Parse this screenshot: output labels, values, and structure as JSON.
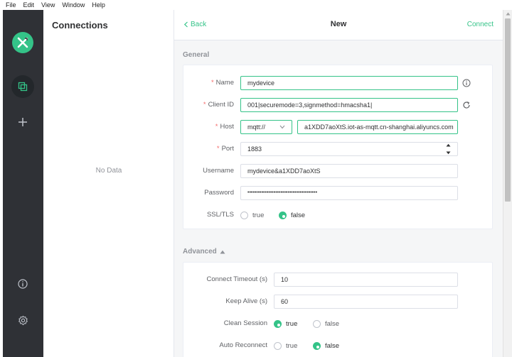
{
  "menu": [
    "File",
    "Edit",
    "Window",
    "Help"
  ],
  "menu_view": "View",
  "colors": {
    "accent": "#34c388",
    "rail": "#2f3136",
    "required": "#f56c6c"
  },
  "sidebar": {
    "icons": [
      "mqttx-logo-icon",
      "connections-icon",
      "plus-icon",
      "info-icon",
      "gear-icon"
    ]
  },
  "connections": {
    "title": "Connections",
    "empty": "No Data"
  },
  "topbar": {
    "back": "Back",
    "title": "New",
    "connect": "Connect"
  },
  "general": {
    "section": "General",
    "name": {
      "label": "Name",
      "value": "mydevice"
    },
    "client_id": {
      "label": "Client ID",
      "value": "001|securemode=3,signmethod=hmacsha1|"
    },
    "host": {
      "label": "Host",
      "protocol": "mqtt://",
      "value": "a1XDD7aoXtS.iot-as-mqtt.cn-shanghai.aliyuncs.com"
    },
    "port": {
      "label": "Port",
      "value": "1883"
    },
    "username": {
      "label": "Username",
      "value": "mydevice&a1XDD7aoXtS"
    },
    "password": {
      "label": "Password",
      "value": "••••••••••••••••••••••••••••••••••••••••"
    },
    "ssl": {
      "label": "SSL/TLS",
      "opt_true": "true",
      "opt_false": "false",
      "selected": "false"
    }
  },
  "advanced": {
    "section": "Advanced",
    "connect_timeout": {
      "label": "Connect Timeout (s)",
      "value": "10"
    },
    "keep_alive": {
      "label": "Keep Alive (s)",
      "value": "60"
    },
    "clean_session": {
      "label": "Clean Session",
      "opt_true": "true",
      "opt_false": "false",
      "selected": "true"
    },
    "auto_reconnect": {
      "label": "Auto Reconnect",
      "opt_true": "true",
      "opt_false": "false",
      "selected": "false"
    }
  }
}
